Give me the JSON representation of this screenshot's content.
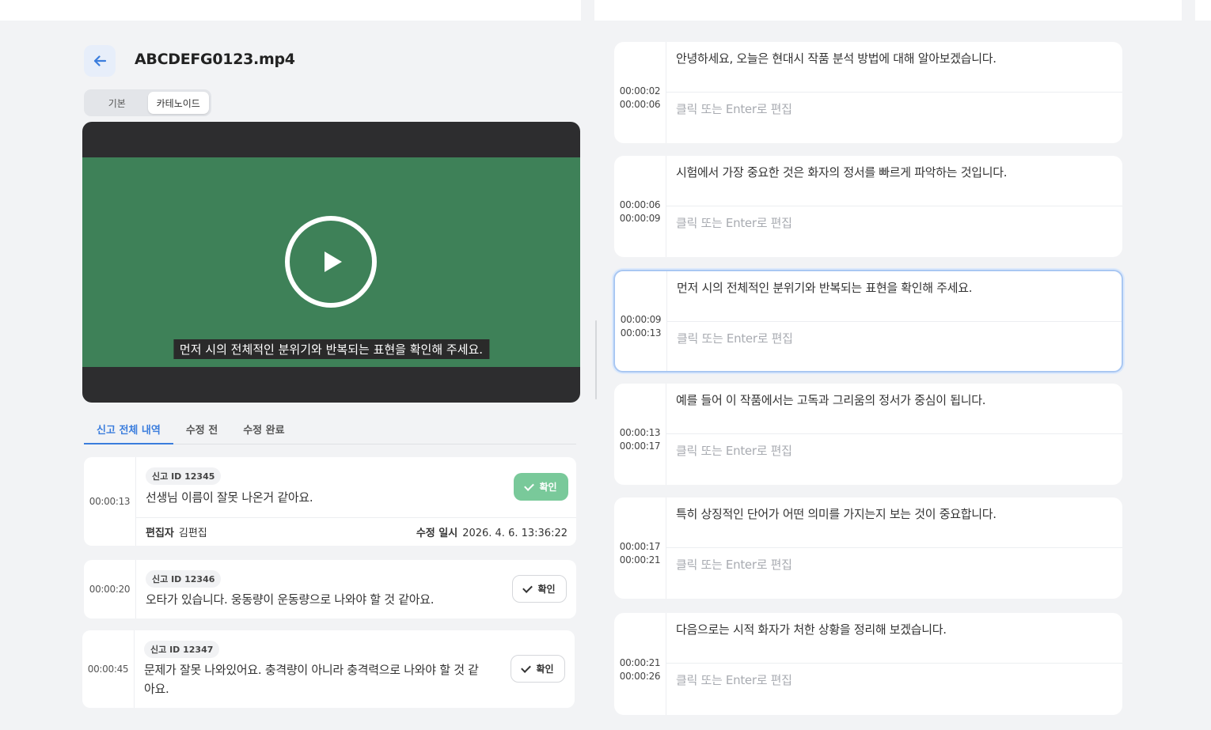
{
  "file": {
    "title": "ABCDEFG0123.mp4"
  },
  "view_toggle": {
    "basic": "기본",
    "karaoke": "카테노이드"
  },
  "video": {
    "caption": "먼저 시의 전체적인 분위기와 반복되는 표현을 확인해 주세요."
  },
  "report_tabs": [
    "신고 전체 내역",
    "수정 전",
    "수정 완료"
  ],
  "reports": [
    {
      "time": "00:00:13",
      "badge": "신고 ID  12345",
      "text": "선생님 이름이 잘못 나온거 같아요.",
      "confirm": "확인",
      "editor_label": "편집자",
      "editor": "김편집",
      "modified_label": "수정 일시",
      "modified": "2026. 4. 6. 13:36:22"
    },
    {
      "time": "00:00:20",
      "badge": "신고 ID  12346",
      "text": "오타가 있습니다. 웅동량이 운동량으로 나와야 할 것 같아요.",
      "confirm": "확인"
    },
    {
      "time": "00:00:45",
      "badge": "신고 ID  12347",
      "text_line1": "문제가 잘못 나와있어요. 충격량이 아니라 충격력으로 나와야 할 것 같",
      "text_line2": "아요.",
      "confirm": "확인"
    }
  ],
  "segments": [
    {
      "start": "00:00:02",
      "end": "00:00:06",
      "text": "안녕하세요, 오늘은 현대시 작품 분석 방법에 대해 알아보겠습니다.",
      "placeholder": "클릭 또는 Enter로 편집"
    },
    {
      "start": "00:00:06",
      "end": "00:00:09",
      "text": "시험에서 가장 중요한 것은 화자의 정서를 빠르게 파악하는 것입니다.",
      "placeholder": "클릭 또는 Enter로 편집"
    },
    {
      "start": "00:00:09",
      "end": "00:00:13",
      "text": "먼저 시의 전체적인 분위기와 반복되는 표현을 확인해 주세요.",
      "placeholder": "클릭 또는 Enter로 편집"
    },
    {
      "start": "00:00:13",
      "end": "00:00:17",
      "text": "예를 들어 이 작품에서는 고독과 그리움의 정서가 중심이 됩니다.",
      "placeholder": "클릭 또는 Enter로 편집"
    },
    {
      "start": "00:00:17",
      "end": "00:00:21",
      "text": "특히 상징적인 단어가 어떤 의미를 가지는지 보는 것이 중요합니다.",
      "placeholder": "클릭 또는 Enter로 편집"
    },
    {
      "start": "00:00:21",
      "end": "00:00:26",
      "text": "다음으로는 시적 화자가 처한 상황을 정리해 보겠습니다.",
      "placeholder": "클릭 또는 Enter로 편집"
    }
  ]
}
